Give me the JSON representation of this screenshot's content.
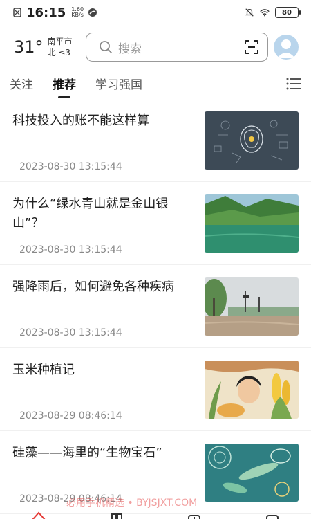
{
  "status": {
    "time": "16:15",
    "speed_value": "1.60",
    "speed_unit": "KB/s",
    "battery": "80"
  },
  "header": {
    "temperature": "31°",
    "city": "南平市",
    "wind": "北 ≤3",
    "search_placeholder": "搜索"
  },
  "tabs": [
    {
      "label": "关注"
    },
    {
      "label": "推荐"
    },
    {
      "label": "学习强国"
    }
  ],
  "feed": [
    {
      "title": "科技投入的账不能这样算",
      "time": "2023-08-30 13:15:44"
    },
    {
      "title": "为什么“绿水青山就是金山银山”？",
      "time": "2023-08-30 13:15:44"
    },
    {
      "title": "强降雨后，如何避免各种疾病",
      "time": "2023-08-30 13:15:44"
    },
    {
      "title": "玉米种植记",
      "time": "2023-08-29 08:46:14"
    },
    {
      "title": "硅藻——海里的“生物宝石”",
      "time": "2023-08-29 08:46:14"
    }
  ],
  "watermark": "必用手机精选 • BYJSJXT.COM",
  "colors": {
    "accent_red": "#e53935",
    "text_primary": "#222222",
    "text_secondary": "#888888"
  }
}
